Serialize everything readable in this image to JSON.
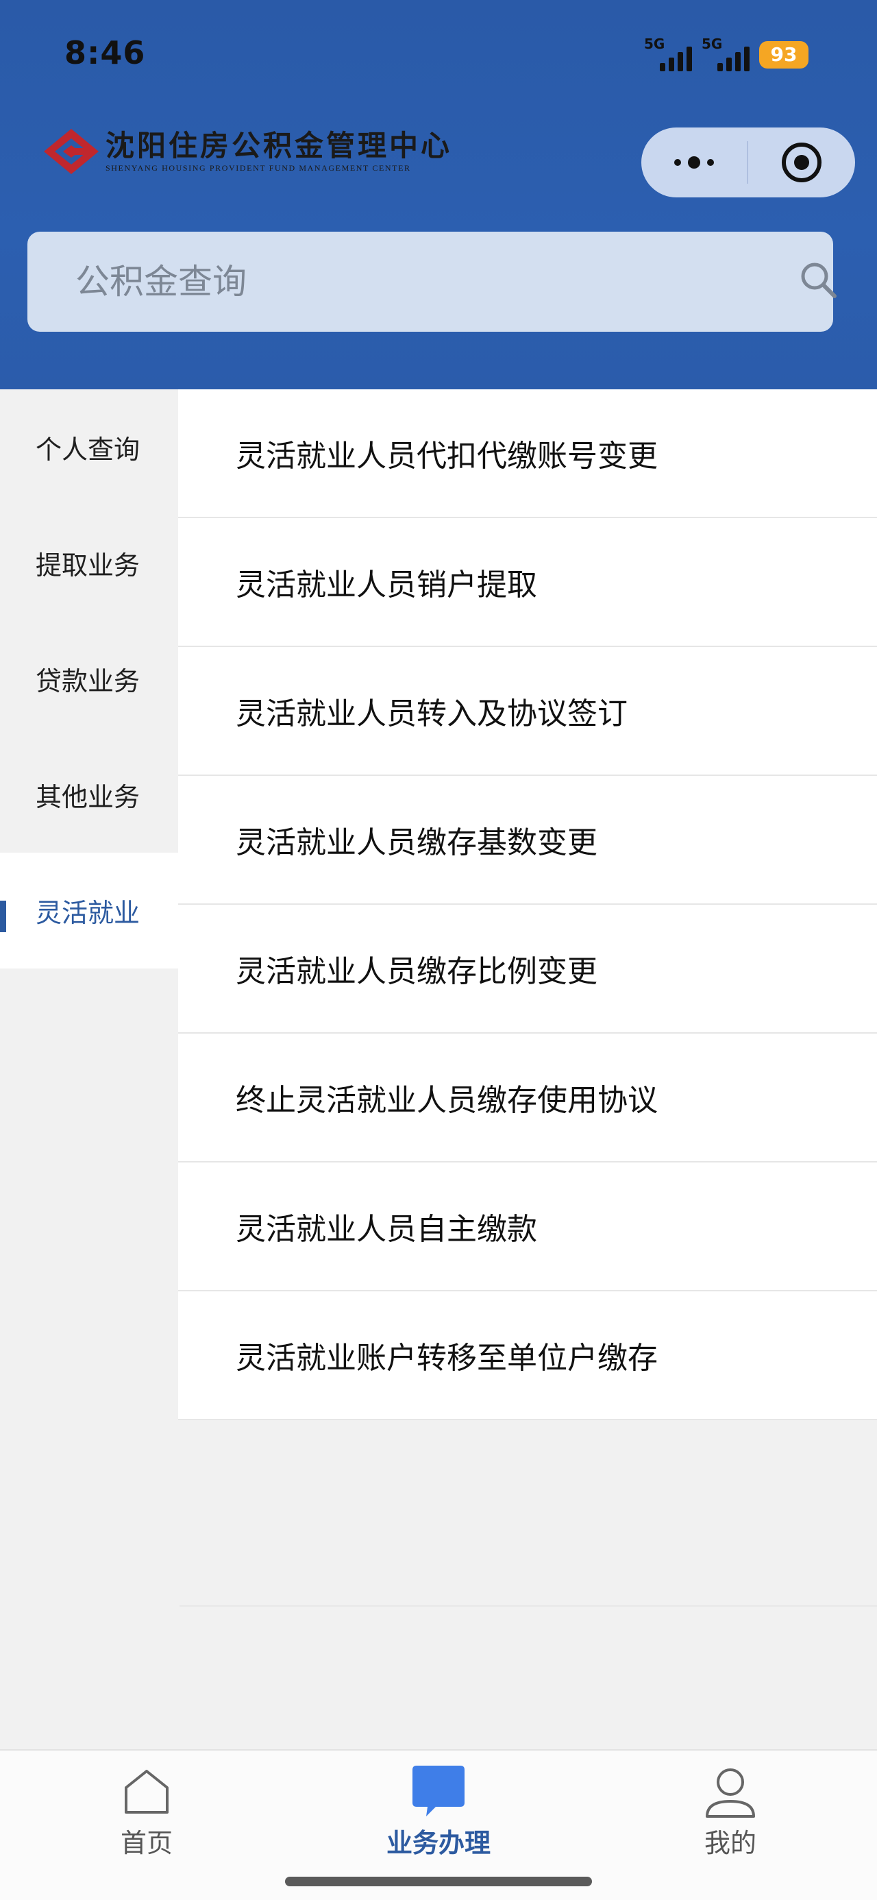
{
  "status_bar": {
    "time": "8:46",
    "signal_1": "5G",
    "signal_2": "5G",
    "battery": "93"
  },
  "header": {
    "logo_title": "沈阳住房公积金管理中心",
    "logo_subtitle": "SHENYANG HOUSING PROVIDENT FUND MANAGEMENT CENTER",
    "brand_color": "#2c5aa0"
  },
  "search": {
    "placeholder": "公积金查询"
  },
  "sidebar": {
    "items": [
      {
        "label": "个人查询",
        "active": false
      },
      {
        "label": "提取业务",
        "active": false
      },
      {
        "label": "贷款业务",
        "active": false
      },
      {
        "label": "其他业务",
        "active": false
      },
      {
        "label": "灵活就业",
        "active": true
      }
    ]
  },
  "list": {
    "items": [
      "灵活就业人员代扣代缴账号变更",
      "灵活就业人员销户提取",
      "灵活就业人员转入及协议签订",
      "灵活就业人员缴存基数变更",
      "灵活就业人员缴存比例变更",
      "终止灵活就业人员缴存使用协议",
      "灵活就业人员自主缴款",
      "灵活就业账户转移至单位户缴存"
    ]
  },
  "tabbar": {
    "tabs": [
      {
        "label": "首页",
        "icon": "home-icon",
        "active": false
      },
      {
        "label": "业务办理",
        "icon": "chat-bubble-icon",
        "active": true
      },
      {
        "label": "我的",
        "icon": "user-icon",
        "active": false
      }
    ]
  }
}
